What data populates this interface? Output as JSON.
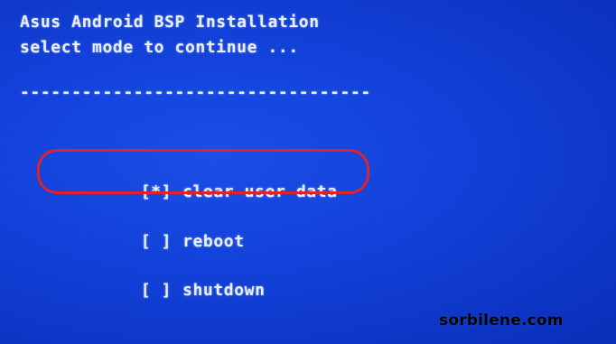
{
  "header": {
    "title": "Asus Android BSP Installation",
    "subtitle": "select mode to continue ...",
    "divider": "----------------------------------"
  },
  "menu": {
    "items": [
      {
        "box": "[*]",
        "label": "clear user data",
        "selected": true
      },
      {
        "box": "[ ]",
        "label": "reboot",
        "selected": false
      },
      {
        "box": "[ ]",
        "label": "shutdown",
        "selected": false
      }
    ]
  },
  "overlay": {
    "watermark": "sorbilene.com",
    "highlight_color": "#e0232a"
  },
  "colors": {
    "background": "#1240d8",
    "text": "#e8f0ff"
  }
}
